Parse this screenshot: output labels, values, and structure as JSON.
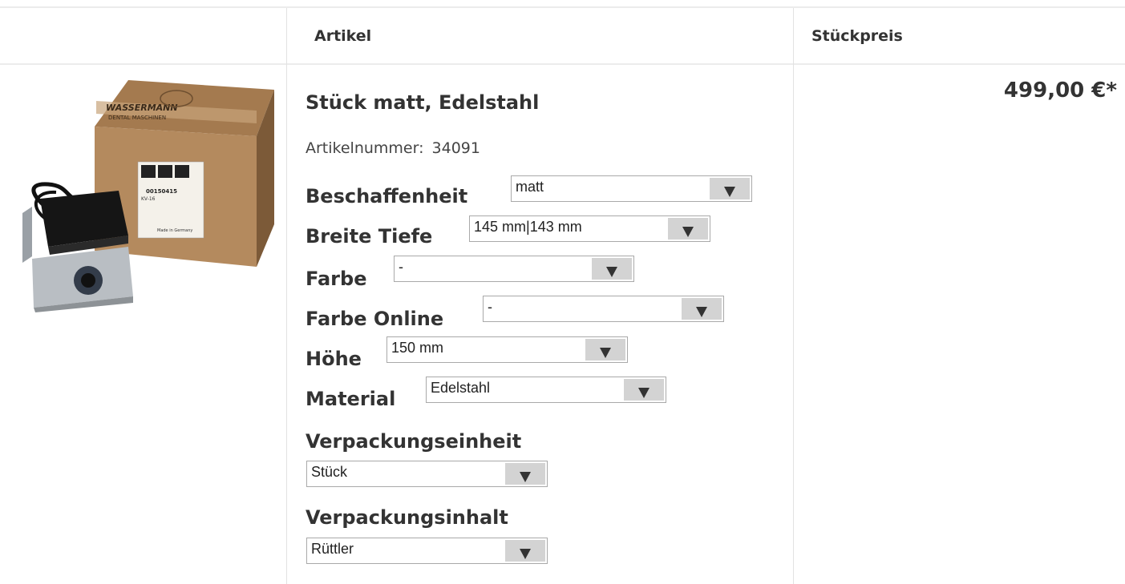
{
  "table": {
    "header": {
      "col_article": "Artikel",
      "col_price": "Stückpreis"
    }
  },
  "product": {
    "title": "Stück matt, Edelstahl",
    "article_number_label": "Artikelnummer:",
    "article_number": "34091",
    "price": "499,00 €*",
    "options": [
      {
        "label": "Beschaffenheit",
        "value": "matt"
      },
      {
        "label": "Breite Tiefe",
        "value": "145 mm|143 mm"
      },
      {
        "label": "Farbe",
        "value": "-"
      },
      {
        "label": "Farbe Online",
        "value": "-"
      },
      {
        "label": "Höhe",
        "value": "150 mm"
      },
      {
        "label": "Material",
        "value": "Edelstahl"
      },
      {
        "label": "Verpackungseinheit",
        "value": "Stück"
      },
      {
        "label": "Verpackungsinhalt",
        "value": "Rüttler"
      }
    ]
  },
  "image": {
    "box_brand": "WASSERMANN",
    "box_subtitle": "DENTAL MASCHINEN",
    "box_code": "00150415",
    "box_model": "KV-16",
    "box_footer": "Made in Germany"
  }
}
